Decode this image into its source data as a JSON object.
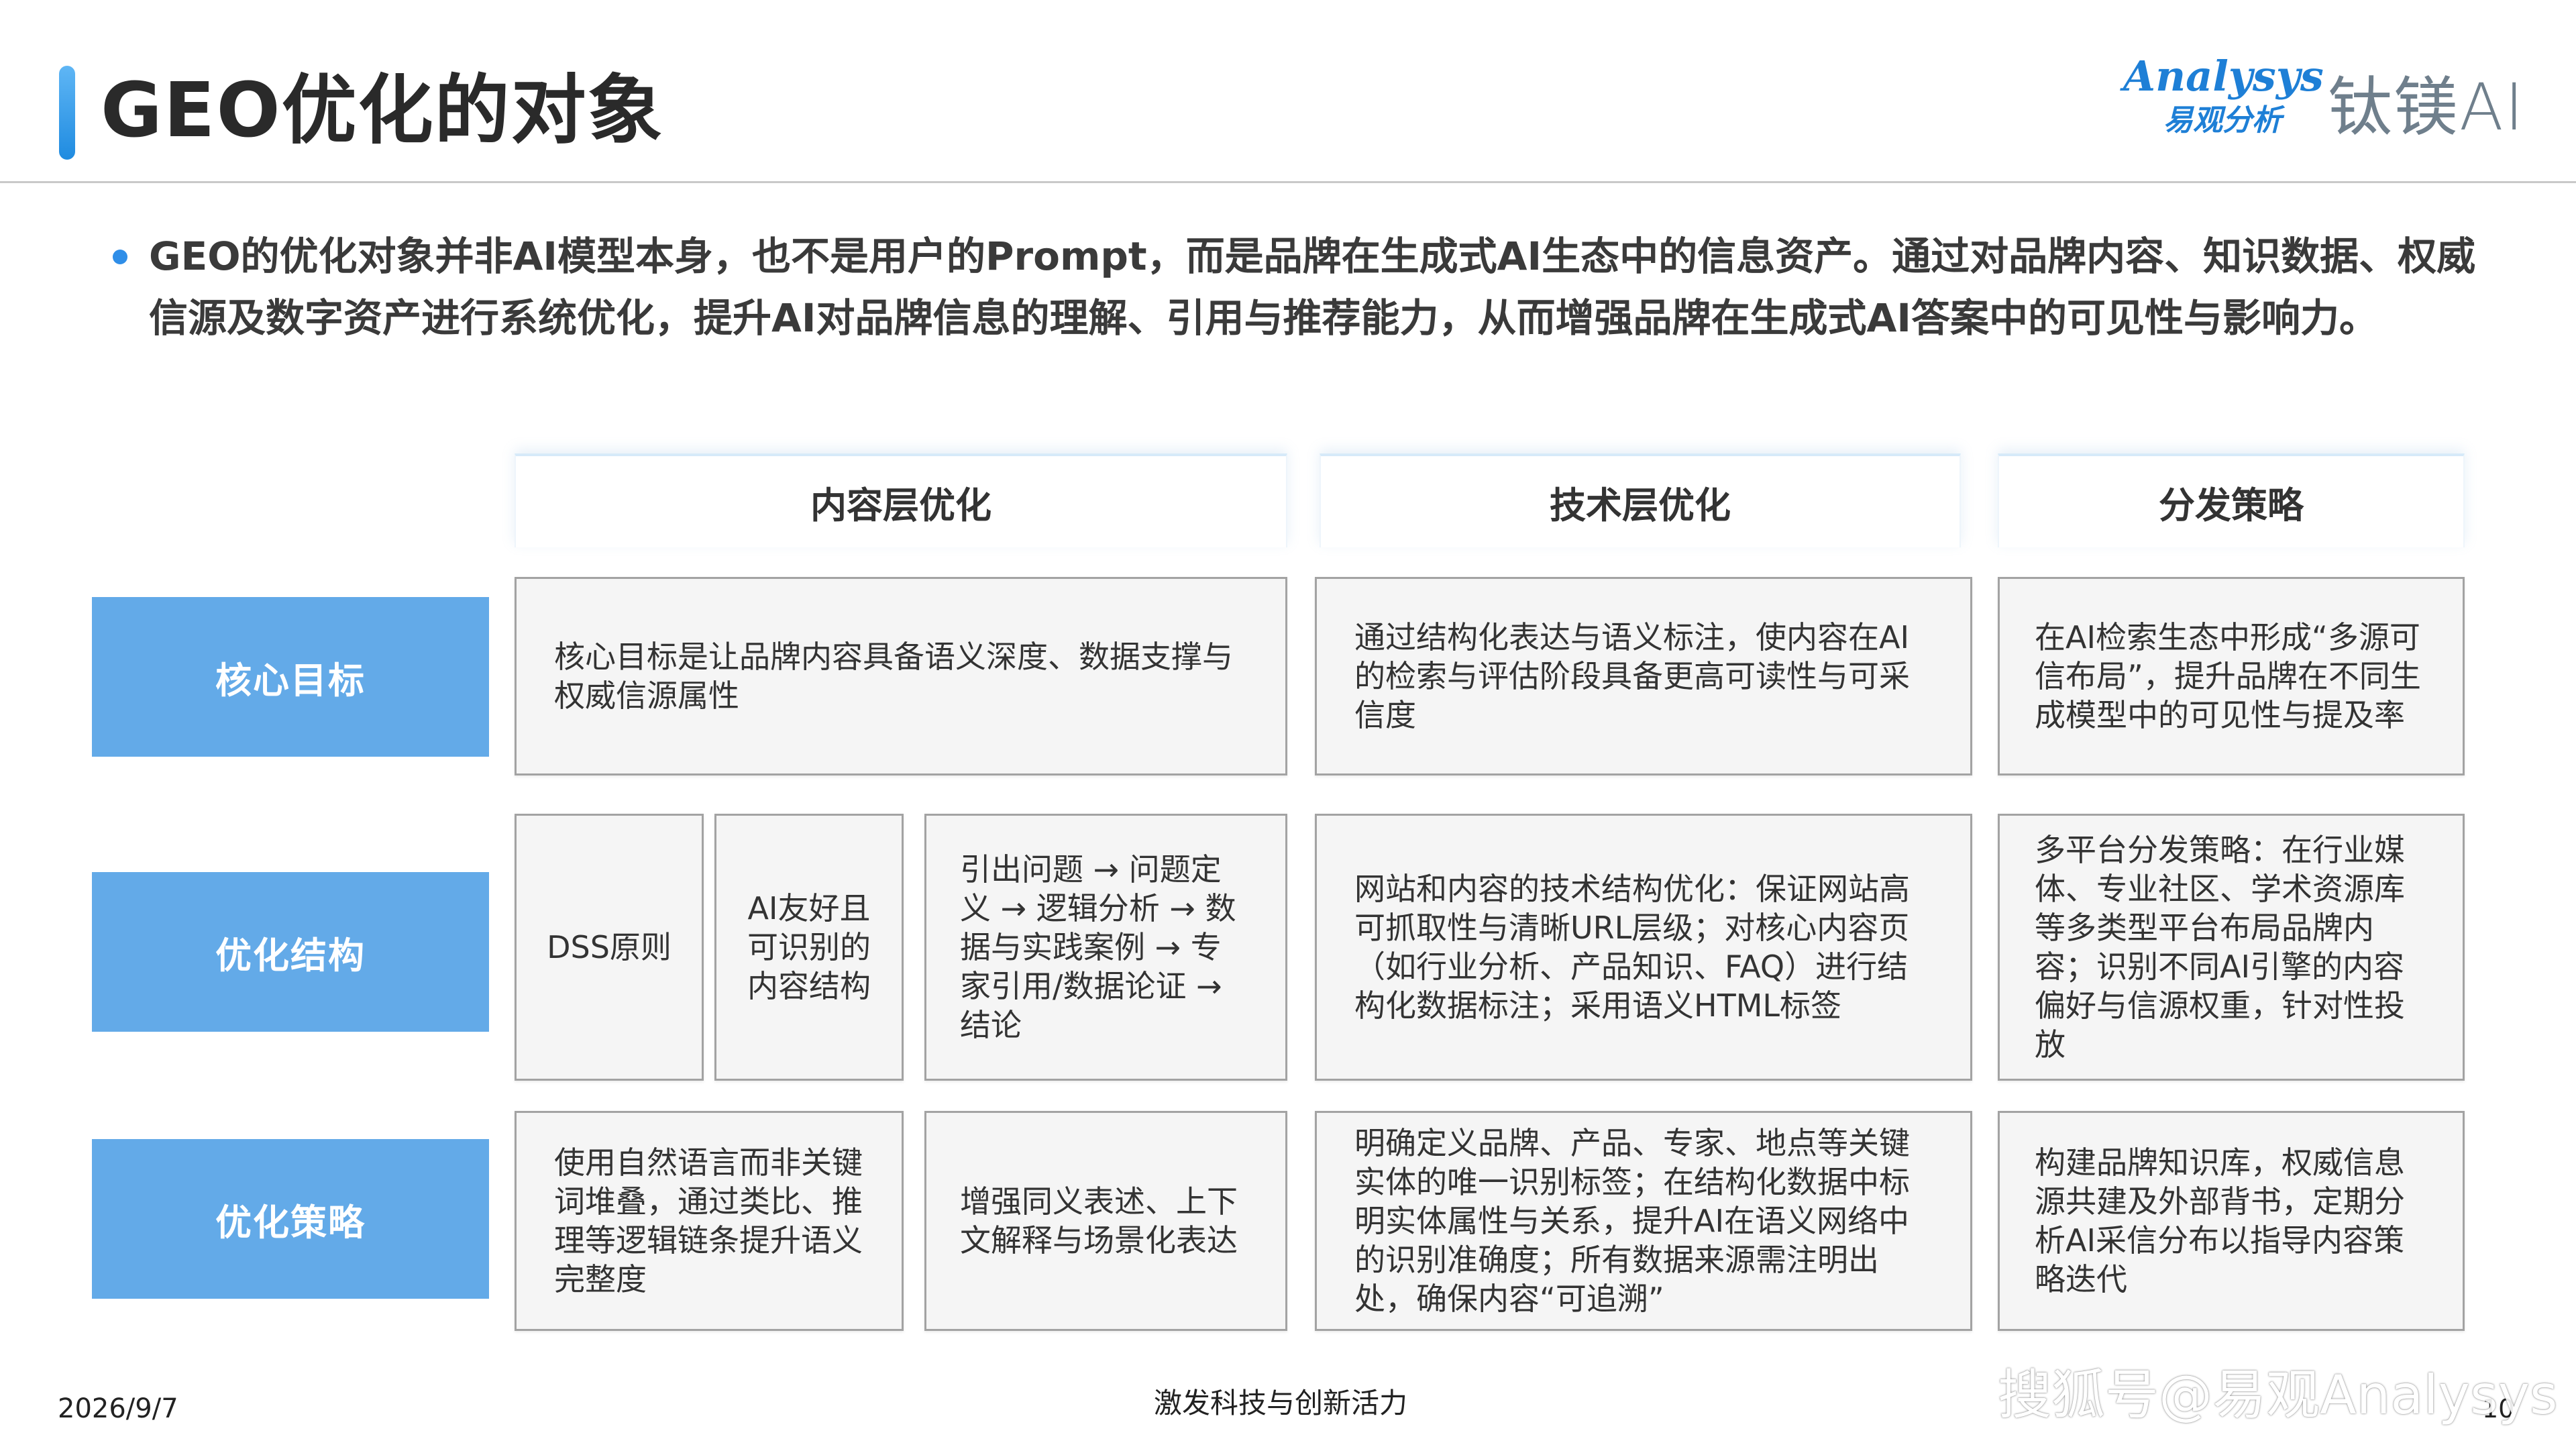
{
  "header": {
    "title": "GEO优化的对象",
    "logo_analysys": "Analysys",
    "logo_analysys_sub": "易观分析",
    "logo_tai": "钛镁AI"
  },
  "intro": {
    "text": "GEO的优化对象并非AI模型本身，也不是用户的Prompt，而是品牌在生成式AI生态中的信息资产。通过对品牌内容、知识数据、权威信源及数字资产进行系统优化，提升AI对品牌信息的理解、引用与推荐能力，从而增强品牌在生成式AI答案中的可见性与影响力。"
  },
  "columns": [
    "内容层优化",
    "技术层优化",
    "分发策略"
  ],
  "rows": {
    "core_goal": {
      "label": "核心目标",
      "content": "核心目标是让品牌内容具备语义深度、数据支撑与权威信源属性",
      "tech": "通过结构化表达与语义标注，使内容在AI的检索与评估阶段具备更高可读性与可采信度",
      "dist": "在AI检索生态中形成“多源可信布局”，提升品牌在不同生成模型中的可见性与提及率"
    },
    "structure": {
      "label": "优化结构",
      "content_a": "DSS原则",
      "content_b": "AI友好且可识别的内容结构",
      "content_c": "引出问题 → 问题定义 → 逻辑分析 → 数据与实践案例 → 专家引用/数据论证 → 结论",
      "tech": "网站和内容的技术结构优化：保证网站高可抓取性与清晰URL层级；对核心内容页（如行业分析、产品知识、FAQ）进行结构化数据标注；采用语义HTML标签",
      "dist": "多平台分发策略：在行业媒体、专业社区、学术资源库等多类型平台布局品牌内容；识别不同AI引擎的内容偏好与信源权重，针对性投放"
    },
    "strategy": {
      "label": "优化策略",
      "content_a": "使用自然语言而非关键词堆叠，通过类比、推理等逻辑链条提升语义完整度",
      "content_b": "增强同义表述、上下文解释与场景化表达",
      "tech": "明确定义品牌、产品、专家、地点等关键实体的唯一识别标签；在结构化数据中标明实体属性与关系，提升AI在语义网络中的识别准确度；所有数据来源需注明出处，确保内容“可追溯”",
      "dist": "构建品牌知识库，权威信息源共建及外部背书，定期分析AI采信分布以指导内容策略迭代"
    }
  },
  "footer": {
    "date": "2026/9/7",
    "slogan": "激发科技与创新活力",
    "page": "10",
    "watermark": "搜狐号@易观Analysys"
  }
}
